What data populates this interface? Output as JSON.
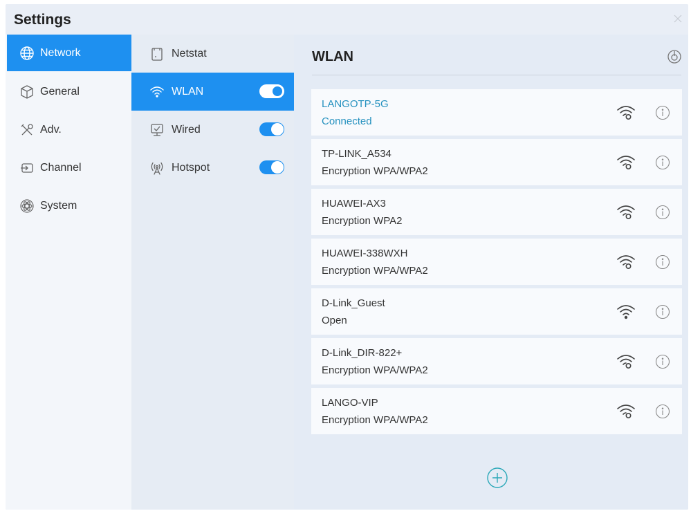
{
  "window": {
    "title": "Settings",
    "close_icon": "close-icon"
  },
  "categories": [
    {
      "label": "Network",
      "icon": "globe-icon",
      "active": true
    },
    {
      "label": "General",
      "icon": "cube-icon",
      "active": false
    },
    {
      "label": "Adv.",
      "icon": "tools-icon",
      "active": false
    },
    {
      "label": "Channel",
      "icon": "input-icon",
      "active": false
    },
    {
      "label": "System",
      "icon": "atom-icon",
      "active": false
    }
  ],
  "network_items": [
    {
      "label": "Netstat",
      "icon": "document-icon",
      "active": false,
      "toggle": null
    },
    {
      "label": "WLAN",
      "icon": "wifi-icon",
      "active": true,
      "toggle": true
    },
    {
      "label": "Wired",
      "icon": "monitor-icon",
      "active": false,
      "toggle": true
    },
    {
      "label": "Hotspot",
      "icon": "hotspot-icon",
      "active": false,
      "toggle": true
    }
  ],
  "main": {
    "title": "WLAN",
    "scan_icon": "scan-icon",
    "add_icon": "add-circle-icon"
  },
  "networks": [
    {
      "name": "LANGOTP-5G",
      "status": "Connected",
      "secured": true,
      "connected": true
    },
    {
      "name": "TP-LINK_A534",
      "status": "Encryption WPA/WPA2",
      "secured": true,
      "connected": false
    },
    {
      "name": "HUAWEI-AX3",
      "status": "Encryption WPA2",
      "secured": true,
      "connected": false
    },
    {
      "name": "HUAWEI-338WXH",
      "status": "Encryption WPA/WPA2",
      "secured": true,
      "connected": false
    },
    {
      "name": "D-Link_Guest",
      "status": "Open",
      "secured": false,
      "connected": false
    },
    {
      "name": "D-Link_DIR-822+",
      "status": "Encryption WPA/WPA2",
      "secured": true,
      "connected": false
    },
    {
      "name": "LANGO-VIP",
      "status": "Encryption WPA/WPA2",
      "secured": true,
      "connected": false
    }
  ],
  "colors": {
    "accent": "#1e90f0",
    "connected_text": "#2591bf",
    "panel_bg": "#e4ebf5"
  }
}
